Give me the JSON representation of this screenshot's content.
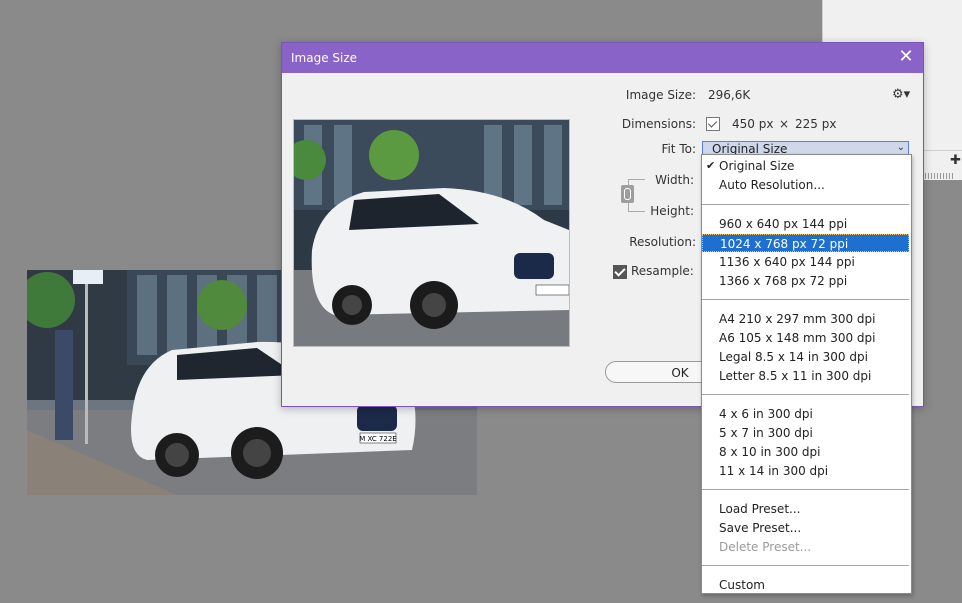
{
  "dialog": {
    "title": "Image Size",
    "image_size_label": "Image Size:",
    "image_size_value": "296,6K",
    "dimensions_label": "Dimensions:",
    "dim_width": "450 px",
    "dim_x": "×",
    "dim_height": "225 px",
    "fit_to_label": "Fit To:",
    "fit_to_value": "Original Size",
    "width_label": "Width:",
    "height_label": "Height:",
    "resolution_label": "Resolution:",
    "resample_label": "Resample:",
    "resample_checked": true,
    "ok_label": "OK"
  },
  "dropdown": {
    "items": [
      {
        "label": "Original Size",
        "checked": true
      },
      {
        "label": "Auto Resolution..."
      },
      {
        "label": "960 x 640 px 144 ppi"
      },
      {
        "label": "1024 x 768 px 72 ppi",
        "selected": true
      },
      {
        "label": "1136 x 640 px 144 ppi"
      },
      {
        "label": "1366 x 768 px 72 ppi"
      },
      {
        "label": "A4 210 x 297 mm 300 dpi"
      },
      {
        "label": "A6 105 x 148 mm 300 dpi"
      },
      {
        "label": "Legal 8.5 x 14 in 300 dpi"
      },
      {
        "label": "Letter 8.5 x 11 in 300 dpi"
      },
      {
        "label": "4 x 6 in 300 dpi"
      },
      {
        "label": "5 x 7 in 300 dpi"
      },
      {
        "label": "8 x 10 in 300 dpi"
      },
      {
        "label": "11 x 14 in 300 dpi"
      },
      {
        "label": "Load Preset..."
      },
      {
        "label": "Save Preset..."
      },
      {
        "label": "Delete Preset...",
        "disabled": true
      },
      {
        "label": "Custom"
      }
    ]
  },
  "photo": {
    "plate_text": "M XC 722E"
  },
  "colors": {
    "titlebar": "#8a63c8",
    "selection": "#1f6fd1",
    "canvas": "#8a8a8a"
  }
}
